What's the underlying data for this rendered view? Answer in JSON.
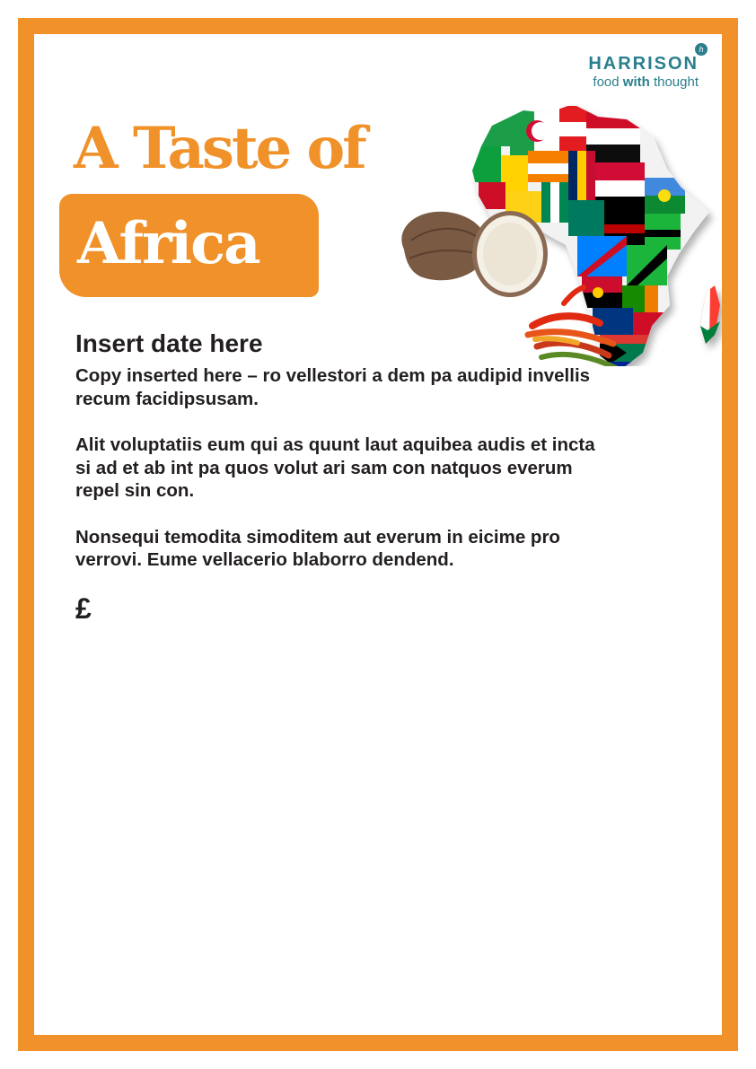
{
  "brand": {
    "name": "HARRISON",
    "tagline_prefix": "food ",
    "tagline_bold": "with",
    "tagline_suffix": " thought"
  },
  "title": {
    "line1": "A Taste of",
    "line2": "Africa"
  },
  "content": {
    "date": "Insert date here",
    "paragraphs": [
      "Copy inserted here – ro vellestori a dem pa audipid invellis recum facidipsusam.",
      "Alit voluptatiis eum qui as quunt laut aquibea audis et incta si ad et ab int pa quos volut ari sam con natquos everum repel sin con.",
      "Nonsequi temodita simoditem aut everum in eicime pro verrovi. Eume vellacerio blaborro dendend."
    ],
    "price": "£"
  },
  "colors": {
    "border": "#f0912a",
    "title_orange": "#f0912a",
    "brand_teal": "#2a7f8c",
    "body_text": "#231f20"
  },
  "icons": {
    "hero_image": "africa-flag-map-with-yam-and-chillies",
    "logo_mark": "harrison-monogram"
  }
}
